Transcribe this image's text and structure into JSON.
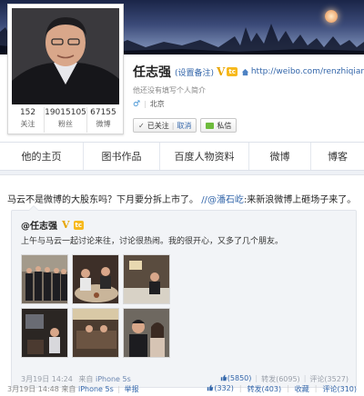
{
  "profile": {
    "name": "任志强",
    "remark": "(设置备注)",
    "level_badge": "tc",
    "url": "http://weibo.com/renzhiqiang",
    "bio": "他还没有填写个人简介",
    "location": "北京",
    "stats": [
      {
        "value": "152",
        "label": "关注"
      },
      {
        "value": "19015105",
        "label": "粉丝"
      },
      {
        "value": "67155",
        "label": "微博"
      }
    ],
    "followed_label": "已关注",
    "cancel_label": "取消",
    "message_label": "私信"
  },
  "tabs": [
    "他的主页",
    "图书作品",
    "百度人物资料",
    "微博",
    "博客"
  ],
  "post": {
    "text": "马云不是微博的大股东吗？下月要分拆上市了。",
    "slash": "//",
    "mention": "@潘石屹",
    "text_suffix": ":来新浪微博上砸场子来了。",
    "repost": {
      "author": "@任志强",
      "badge": "tc",
      "text": "上午与马云一起讨论来往，讨论很热闹。我的很开心，又多了几个朋友。",
      "time": "3月19日 14:24",
      "from": "来自",
      "source": "iPhone 5s",
      "likes": "(5850)",
      "reposts": "转发(6095)",
      "comments": "评论(3527)"
    },
    "time": "3月19日 14:48",
    "from": "来自",
    "source": "iPhone 5s",
    "report": "举报",
    "likes": "(332)",
    "reposts": "转发(403)",
    "favorite": "收藏",
    "comments": "评论(310)"
  },
  "colors": {
    "link": "#3366aa",
    "vip": "#e7a500",
    "level": "#f7b91d",
    "message": "#6dbb3c"
  }
}
